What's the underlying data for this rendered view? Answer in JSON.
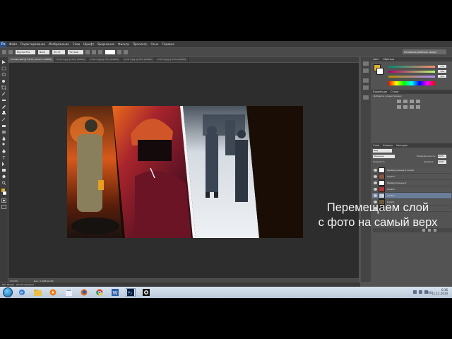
{
  "app": {
    "logo": "Ps"
  },
  "menu": [
    "Файл",
    "Редактирование",
    "Изображение",
    "Слои",
    "Шрифт",
    "Выделение",
    "Фильтр",
    "Просмотр",
    "Окно",
    "Справка"
  ],
  "options": {
    "font_family": "Myriad Pro",
    "font_style": "Bold",
    "font_size": "30 пт",
    "aa_mode": "Четкое",
    "workspace": "Основная рабочая среда"
  },
  "tabs": [
    "коллаж.psd @ 33,3% (Слой 4, RGB/8)",
    "Слой 1.jpg @ 50% (RGB/8)",
    "Слой 2.jpg @ 50% (RGB/8)",
    "Слой 3.jpg @ 50% (RGB/8)",
    "Слой 4.jpg @ 50% (RGB/8)"
  ],
  "status": {
    "zoom": "33,33%",
    "doc_size": "Док: 2,64M/16,2M"
  },
  "minibridge": [
    "Mini Bridge",
    "Шкала времени"
  ],
  "panels": {
    "color_tabs": [
      "Цвет",
      "Образцы"
    ],
    "color_values": [
      "176",
      "140",
      "111"
    ],
    "adjust_tabs": [
      "Коррекция",
      "Стили"
    ],
    "adjust_title": "Добавить корректировку",
    "layers_tabs": [
      "Слои",
      "Каналы",
      "Контуры"
    ],
    "filter_label": "Вид",
    "blend_mode": "Обычные",
    "opacity_label": "Непрозрачность:",
    "opacity_value": "100%",
    "lock_label": "Закрепить:",
    "fill_label": "Заливка:",
    "fill_value": "100%",
    "layers": [
      "Прямоугольник 2 копия",
      "Слой 3",
      "Прямоугольник 2",
      "Слой 2",
      "Слой 4",
      "Слой 1",
      "Фон"
    ],
    "selected_layer_index": 4
  },
  "caption": {
    "line1": "Перемещаем слой",
    "line2": "с фото на самый верх"
  },
  "tray": {
    "lang": "RU",
    "time": "0:16",
    "date": "11.11.2014"
  }
}
